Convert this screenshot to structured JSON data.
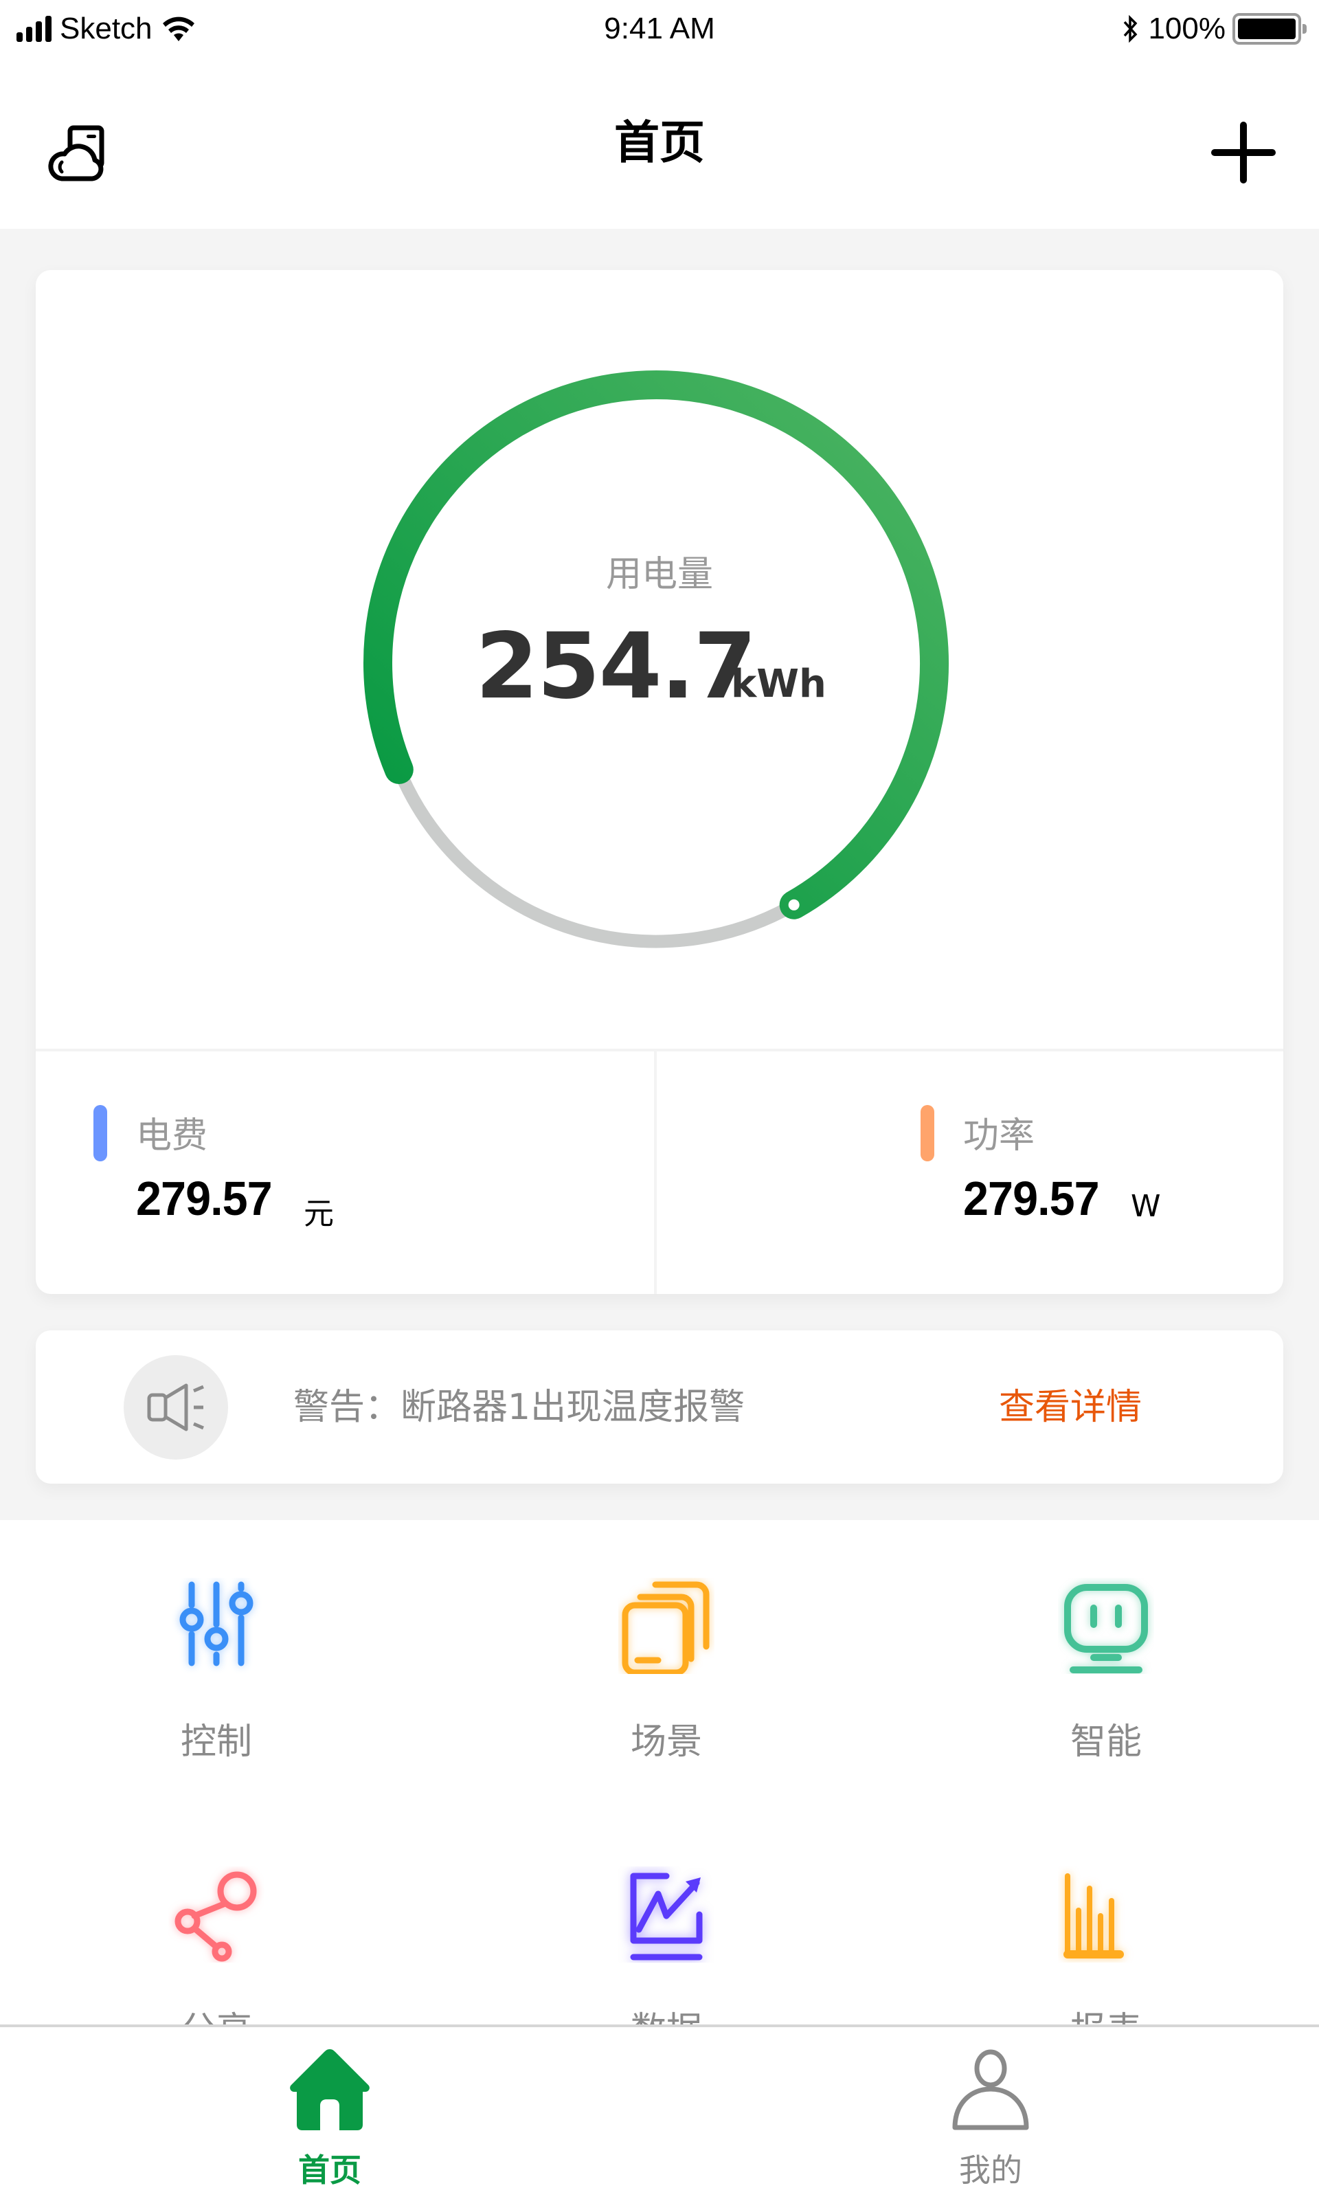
{
  "status_bar": {
    "carrier": "Sketch",
    "time": "9:41 AM",
    "battery_percent": "100%",
    "battery_level": 1.0
  },
  "nav": {
    "title": "首页",
    "left_icon": "weather-cloud-icon",
    "right_icon": "plus-icon"
  },
  "gauge": {
    "label": "用电量",
    "value": "254.7",
    "unit": "kWh",
    "progress": 0.73,
    "colors": {
      "arc_start": "#00963f",
      "arc_end": "#4fb563",
      "track": "#cacccb"
    }
  },
  "metrics": [
    {
      "label": "电费",
      "value": "279.57",
      "unit": "元",
      "accent": "#6b95ff"
    },
    {
      "label": "功率",
      "value": "279.57",
      "unit": "W",
      "accent": "#ffa46b"
    }
  ],
  "alert": {
    "icon": "speaker-icon",
    "message": "警告：断路器1出现温度报警",
    "link_label": "查看详情",
    "link_color": "#e8570a"
  },
  "grid": [
    {
      "label": "控制",
      "icon": "sliders-icon",
      "color": "#3a8ff7"
    },
    {
      "label": "场景",
      "icon": "scene-cards-icon",
      "color": "#ffab1f"
    },
    {
      "label": "智能",
      "icon": "robot-monitor-icon",
      "color": "#45c196"
    },
    {
      "label": "分享",
      "icon": "share-icon",
      "color": "#ff6f78"
    },
    {
      "label": "数据",
      "icon": "trend-chart-icon",
      "color": "#5b3bfb"
    },
    {
      "label": "报表",
      "icon": "bar-report-icon",
      "color": "#ffab1f"
    }
  ],
  "tab_bar": {
    "tabs": [
      {
        "label": "首页",
        "icon": "home-icon",
        "active": true,
        "color": "#0a9a45"
      },
      {
        "label": "我的",
        "icon": "user-icon",
        "active": false,
        "color": "#8a8a8a"
      }
    ]
  }
}
